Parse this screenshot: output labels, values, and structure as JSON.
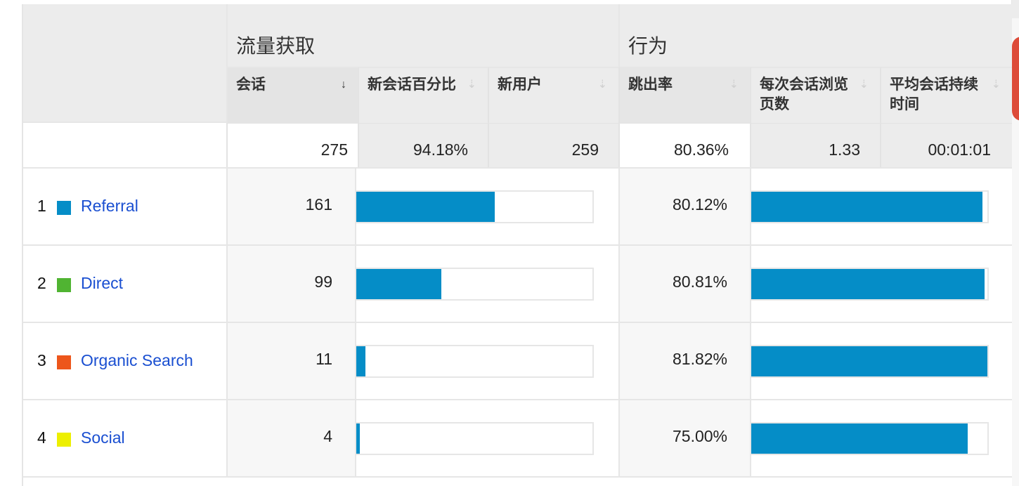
{
  "groups": {
    "acquisition": "流量获取",
    "behavior": "行为"
  },
  "columns": [
    {
      "key": "sessions",
      "label": "会话",
      "sorted": true
    },
    {
      "key": "pct_new_sessions",
      "label": "新会话百分比",
      "sorted": false
    },
    {
      "key": "new_users",
      "label": "新用户",
      "sorted": false
    },
    {
      "key": "bounce_rate",
      "label": "跳出率",
      "sorted": false
    },
    {
      "key": "pages_per_session",
      "label": "每次会话浏览页数",
      "sorted": false
    },
    {
      "key": "avg_session_duration",
      "label": "平均会话持续时间",
      "sorted": false
    }
  ],
  "sort_icons": {
    "active": "↓",
    "inactive": "⇣"
  },
  "totals": {
    "sessions": "275",
    "pct_new_sessions": "94.18%",
    "new_users": "259",
    "bounce_rate": "80.36%",
    "pages_per_session": "1.33",
    "avg_session_duration": "00:01:01"
  },
  "colors": {
    "bar": "#058dc7",
    "link": "#1a4fd1"
  },
  "rows": [
    {
      "index": "1",
      "channel": "Referral",
      "swatch": "#058dc7",
      "sessions": "161",
      "sessions_fraction": 0.5855,
      "bounce_rate": "80.12%",
      "bounce_fraction": 0.9792
    },
    {
      "index": "2",
      "channel": "Direct",
      "swatch": "#50b432",
      "sessions": "99",
      "sessions_fraction": 0.36,
      "bounce_rate": "80.81%",
      "bounce_fraction": 0.9877
    },
    {
      "index": "3",
      "channel": "Organic Search",
      "swatch": "#ed561b",
      "sessions": "11",
      "sessions_fraction": 0.04,
      "bounce_rate": "81.82%",
      "bounce_fraction": 1.0
    },
    {
      "index": "4",
      "channel": "Social",
      "swatch": "#edef00",
      "sessions": "4",
      "sessions_fraction": 0.0145,
      "bounce_rate": "75.00%",
      "bounce_fraction": 0.9167
    }
  ]
}
